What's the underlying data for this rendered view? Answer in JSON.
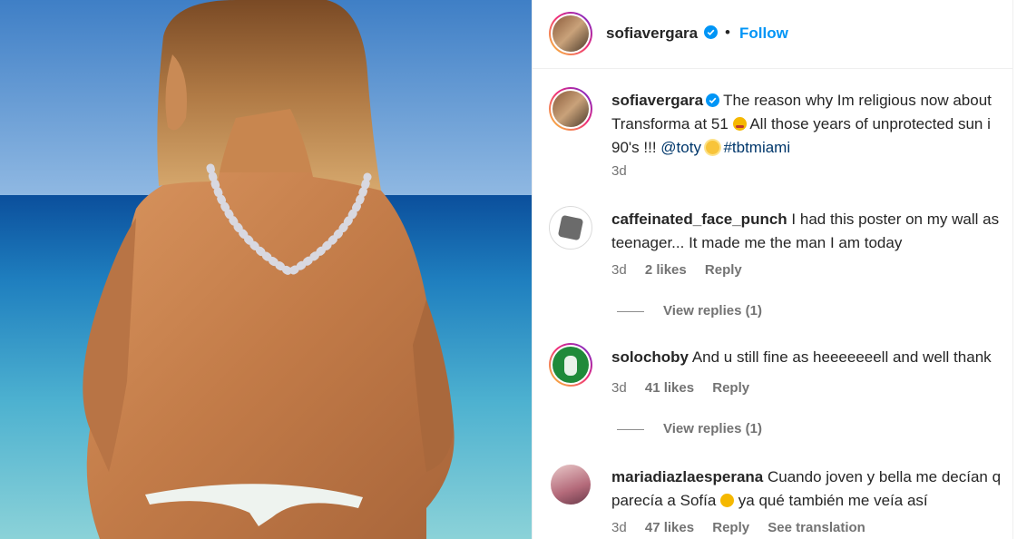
{
  "post": {
    "image_alt": "Photo of a woman at the beach",
    "header": {
      "username": "sofiavergara",
      "dot": "•",
      "follow_label": "Follow"
    },
    "caption": {
      "username": "sofiavergara",
      "line1": "The reason why Im religious now about",
      "line2": "Transforma at 51",
      "line2_rest": "All those years of unprotected sun i",
      "line3_start": "90's !!!",
      "mention": "@toty",
      "hashtag": "#tbtmiami",
      "time": "3d"
    },
    "comments": [
      {
        "username": "caffeinated_face_punch",
        "line1": "I had this poster on my wall as",
        "line2": "teenager... It made me the man I am today",
        "time": "3d",
        "likes": "2 likes",
        "reply": "Reply",
        "view_replies": "View replies (1)"
      },
      {
        "username": "solochoby",
        "line1": "And u still fine as heeeeeeell and well thank",
        "time": "3d",
        "likes": "41 likes",
        "reply": "Reply",
        "view_replies": "View replies (1)"
      },
      {
        "username": "mariadiazlaesperana",
        "line1": "Cuando joven y bella me decían q",
        "line2_start": "parecía a Sofía",
        "line2_end": "ya qué también me veía así",
        "time": "3d",
        "likes": "47 likes",
        "reply": "Reply",
        "see_translation": "See translation"
      }
    ]
  },
  "colors": {
    "accent": "#0095f6",
    "link": "#00376b",
    "muted": "#737373",
    "verified": "#0095f6"
  },
  "icons": [
    "verified-badge-icon",
    "persevering-face-emoji",
    "sun-emoji",
    "wink-emoji"
  ]
}
